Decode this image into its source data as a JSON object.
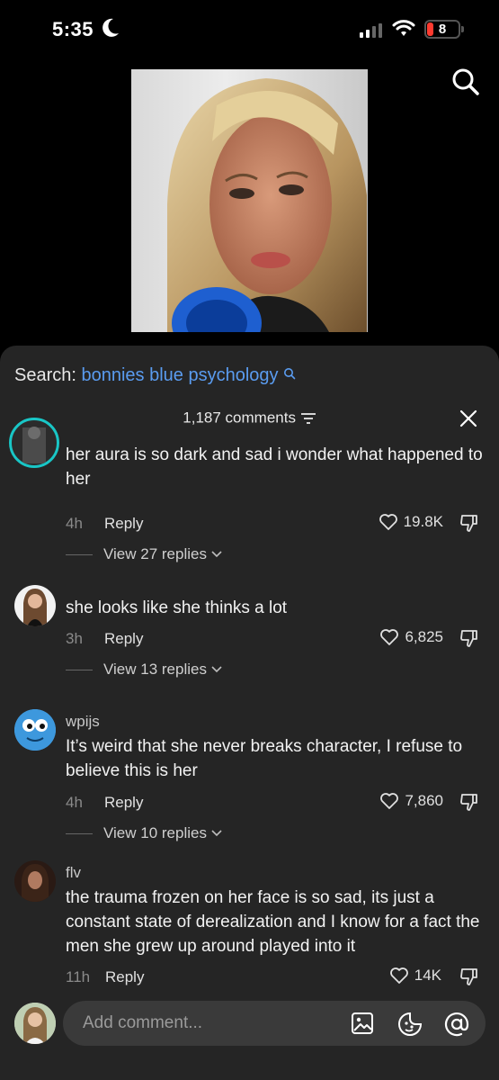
{
  "status_bar": {
    "time": "5:35",
    "battery": "8"
  },
  "sheet": {
    "search_label": "Search:",
    "search_query": "bonnies blue psychology",
    "comment_count": "1,187 comments"
  },
  "comments": [
    {
      "username": "",
      "text": "her aura is so dark and sad i wonder what happened to her",
      "time": "4h",
      "reply_label": "Reply",
      "likes": "19.8K",
      "view_replies": "View 27 replies"
    },
    {
      "username": "",
      "text": "she looks like she thinks a lot",
      "time": "3h",
      "reply_label": "Reply",
      "likes": "6,825",
      "view_replies": "View 13 replies"
    },
    {
      "username": "wpijs",
      "text": "It’s weird that she never breaks character, I refuse to believe this is her",
      "time": "4h",
      "reply_label": "Reply",
      "likes": "7,860",
      "view_replies": "View 10 replies"
    },
    {
      "username": "flv",
      "text": "the trauma frozen on her face is so sad, its just a constant state of derealization and I know for a fact the men she grew up around played into it",
      "time": "11h",
      "reply_label": "Reply",
      "likes": "14K"
    }
  ],
  "input": {
    "placeholder": "Add comment..."
  },
  "icons": {
    "moon": "moon-icon",
    "signal": "cellular-signal-icon",
    "wifi": "wifi-icon",
    "search": "search-icon",
    "filter": "sort-filter-icon",
    "close": "close-icon",
    "heart": "heart-icon",
    "dislike": "thumbs-down-icon",
    "chevron": "chevron-down-icon",
    "image": "image-icon",
    "emoji": "emoji-icon",
    "mention": "at-mention-icon"
  },
  "colors": {
    "link": "#5a9cf0",
    "sheet_bg": "#252525",
    "battery_low": "#ff3b30"
  }
}
